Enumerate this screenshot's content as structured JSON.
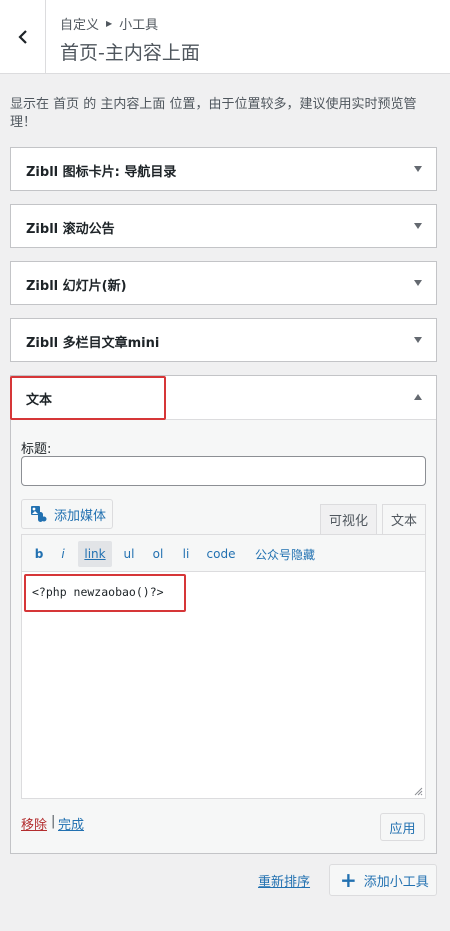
{
  "header": {
    "breadcrumb_root": "自定义",
    "breadcrumb_current": "小工具",
    "title": "首页-主内容上面"
  },
  "description": "显示在 首页 的 主内容上面 位置，由于位置较多，建议使用实时预览管理！",
  "widgets": [
    {
      "title": "Zibll 图标卡片: 导航目录"
    },
    {
      "title": "Zibll 滚动公告"
    },
    {
      "title": "Zibll 幻灯片(新)"
    },
    {
      "title": "Zibll 多栏目文章mini"
    }
  ],
  "open_widget": {
    "title": "文本",
    "field_label": "标题:",
    "field_value": "",
    "add_media_label": "添加媒体",
    "tab_visual": "可视化",
    "tab_text": "文本",
    "toolbar": [
      "b",
      "i",
      "link",
      "ul",
      "ol",
      "li",
      "code",
      "公众号隐藏"
    ],
    "content": "<?php newzaobao()?>",
    "remove_label": "移除",
    "separator": "|",
    "done_label": "完成",
    "apply_label": "应用"
  },
  "footer": {
    "reorder_label": "重新排序",
    "add_widget_label": "添加小工具"
  },
  "colors": {
    "link": "#2271b1",
    "highlight": "#d63638",
    "remove": "#b32d2e"
  }
}
